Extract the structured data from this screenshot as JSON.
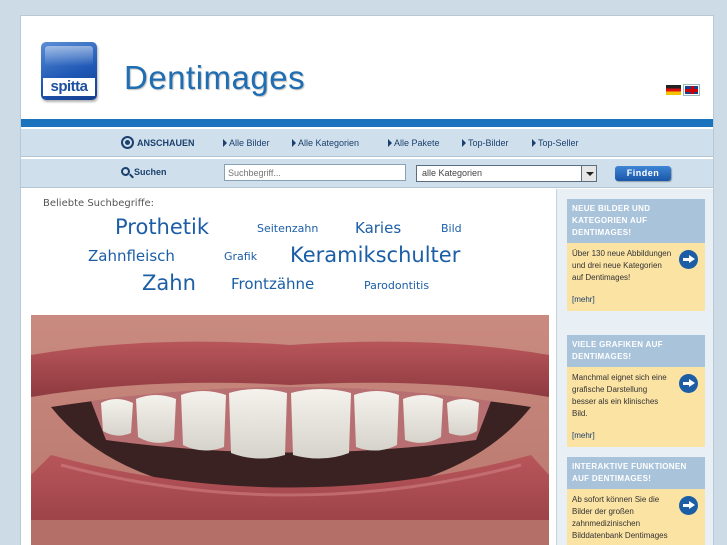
{
  "header": {
    "logo_text": "spitta",
    "site_title": "Dentimages",
    "languages": [
      "de-flag",
      "uk-flag"
    ]
  },
  "nav": {
    "primary": "ANSCHAUEN",
    "items": [
      "Alle Bilder",
      "Alle Kategorien",
      "Alle Pakete",
      "Top-Bilder",
      "Top-Seller"
    ]
  },
  "search": {
    "label": "Suchen",
    "placeholder": "Suchbegriff...",
    "category_selected": "alle Kategorien",
    "button": "Finden"
  },
  "tags": {
    "title": "Beliebte Suchbegriffe:",
    "items": [
      "Prothetik",
      "Seitenzahn",
      "Karies",
      "Bild",
      "Zahnfleisch",
      "Grafik",
      "Keramikschulter",
      "Zahn",
      "Frontzähne",
      "Parodontitis"
    ]
  },
  "sidebar": {
    "boxes": [
      {
        "header": "NEUE BILDER UND KATEGORIEN AUF DENTIMAGES!",
        "body": "Über 130 neue Abbildungen und drei neue Kategorien auf Dentimages!",
        "more": "[mehr]"
      },
      {
        "header": "VIELE GRAFIKEN AUF DENTIMAGES!",
        "body": "Manchmal eignet sich eine grafische Darstellung besser als ein klinisches Bild.",
        "more": "[mehr]"
      },
      {
        "header": "INTERAKTIVE FUNKTIONEN AUF DENTIMAGES!",
        "body": "Ab sofort können Sie die Bilder der großen zahnmedizinischen Bilddatenbank Dentimages",
        "more": ""
      }
    ]
  },
  "colors": {
    "accent": "#1b73be",
    "link": "#1b5ea6",
    "info_box": "#fbe3a4"
  }
}
